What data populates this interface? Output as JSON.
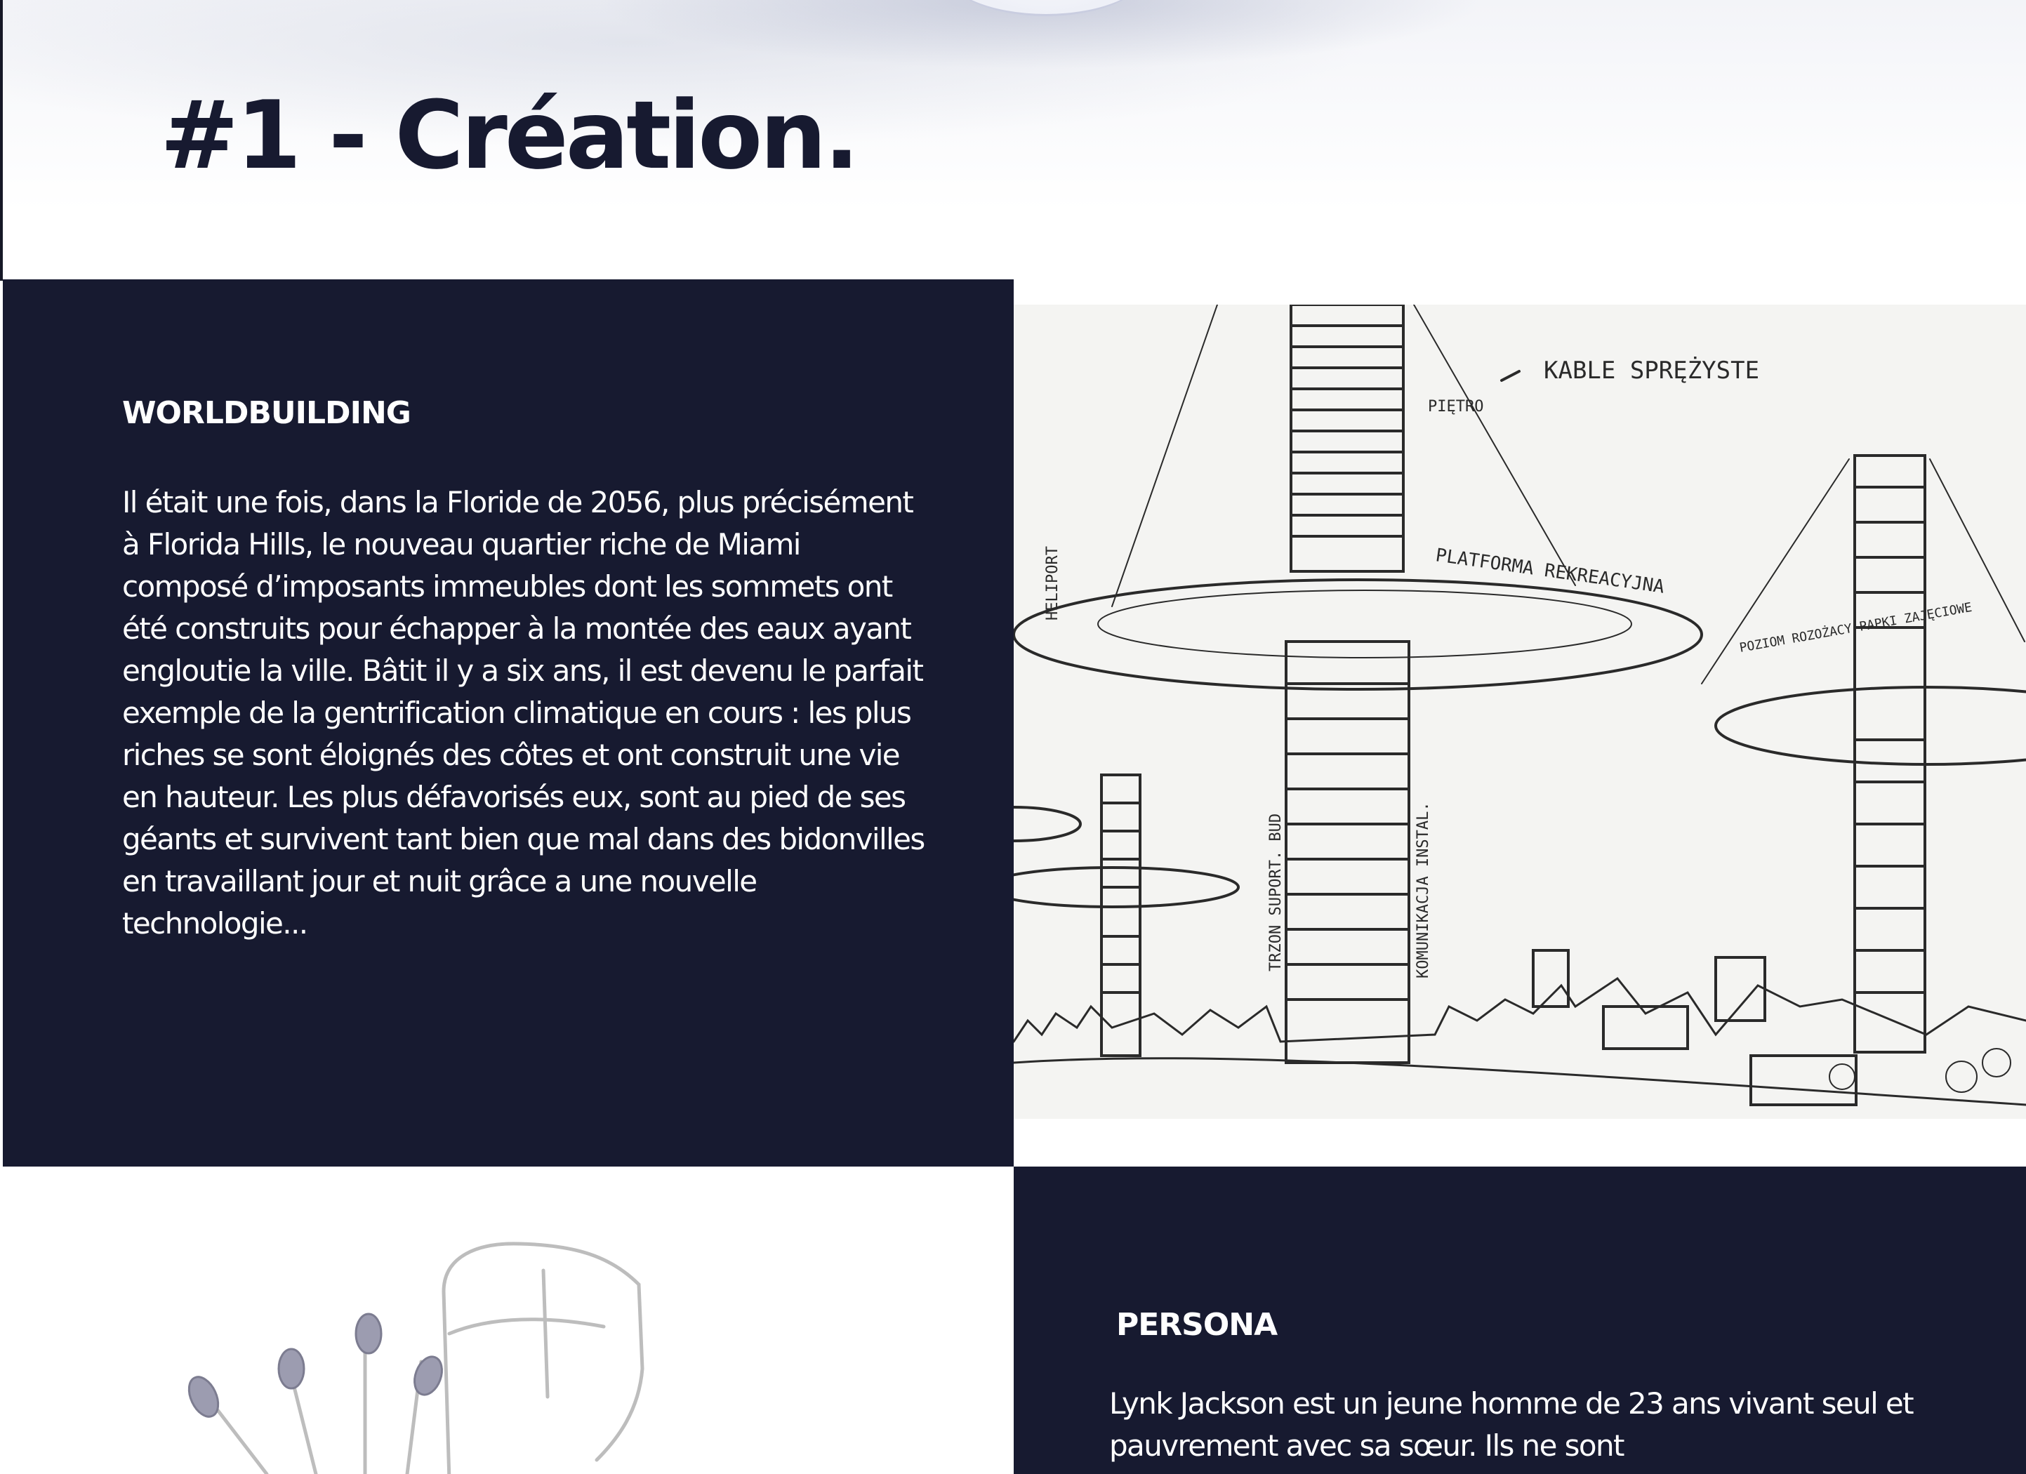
{
  "hero": {
    "title": "#1 - Création."
  },
  "worldbuilding": {
    "heading": "WORLDBUILDING",
    "body": "Il était une fois, dans la Floride de 2056, plus précisément à Florida Hills, le nouveau quartier riche de Miami composé d’imposants immeubles dont les sommets ont été construits pour échapper à la montée des eaux ayant engloutie la ville. Bâtit il y a six ans, il est devenu le parfait exemple de la gentrification climatique en cours : les plus riches se sont éloignés des côtes et ont construit une vie en hauteur. Les plus défavorisés eux, sont au pied de ses géants et survivent tant bien que mal dans des bidonvilles en travaillant jour et nuit grâce a une nouvelle technologie..."
  },
  "sketch": {
    "labels": {
      "cables": "KABLE SPRĘŻYSTE",
      "floor": "PIĘTRO",
      "heliport": "HELIPORT",
      "platform": "PLATFORMA REKREACYJNA",
      "level": "POZIOM ROZOŻACY PAPKI ZAJĘCIOWE",
      "structure": "TRZON SUPORT. BUD",
      "communication": "KOMUNIKACJA INSTAL."
    }
  },
  "persona": {
    "heading": "PERSONA",
    "body": "Lynk Jackson est un jeune homme de 23 ans vivant seul et pauvrement avec sa sœur. Ils ne sont"
  },
  "colors": {
    "navy": "#171a30",
    "white": "#ffffff",
    "sketch_paper": "#f4f4f2",
    "ink": "#2a2a2a"
  }
}
